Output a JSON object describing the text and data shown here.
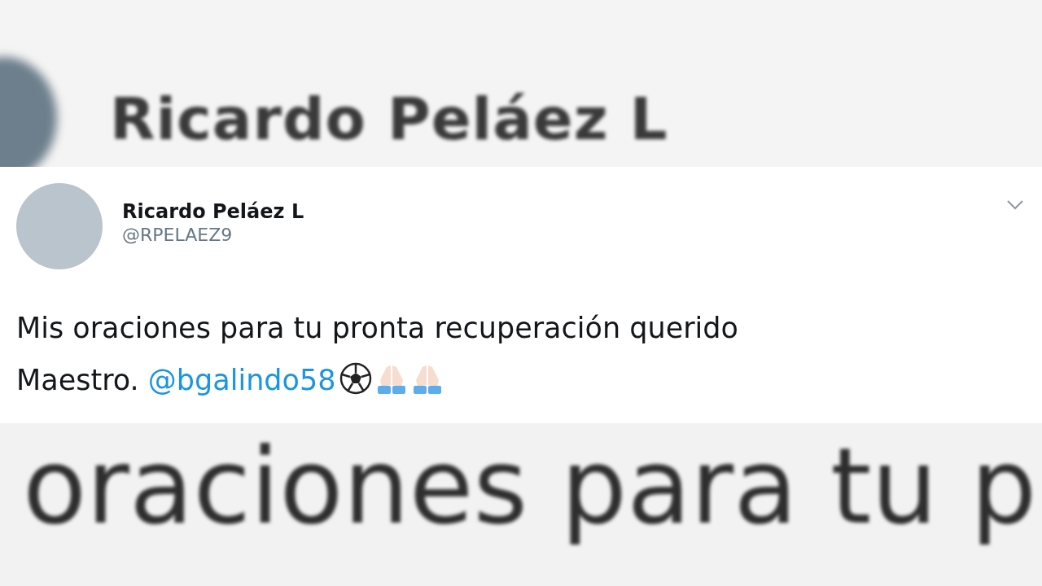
{
  "background_top": {
    "text": "Ricardo Peláez L"
  },
  "tweet": {
    "author_name": "Ricardo Peláez L",
    "handle": "@RPELAEZ9",
    "text_lines": [
      {
        "parts": [
          {
            "kind": "text",
            "value": "Mis oraciones para tu pronta recuperación querido"
          }
        ]
      },
      {
        "parts": [
          {
            "kind": "text",
            "value": "Maestro. "
          },
          {
            "kind": "mention",
            "value": "@bgalindo58"
          },
          {
            "kind": "ball_emoji"
          },
          {
            "kind": "pray_emoji"
          },
          {
            "kind": "pray_emoji"
          }
        ]
      }
    ]
  },
  "background_bottom": {
    "text": "oraciones para tu p"
  }
}
